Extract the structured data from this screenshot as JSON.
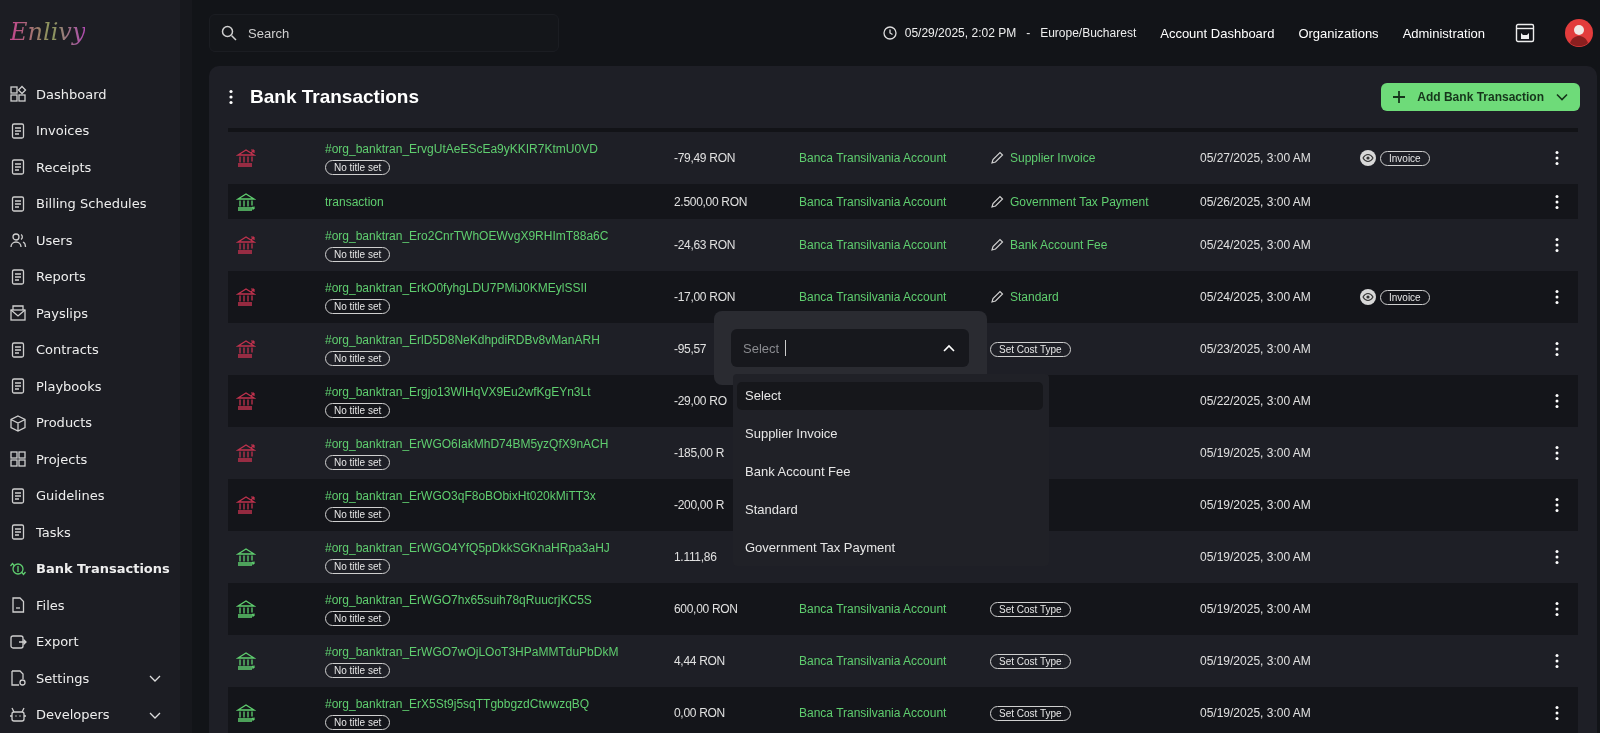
{
  "logo": "Enlivy",
  "sidebar": {
    "items": [
      {
        "label": "Dashboard",
        "selected": false
      },
      {
        "label": "Invoices",
        "selected": false
      },
      {
        "label": "Receipts",
        "selected": false
      },
      {
        "label": "Billing Schedules",
        "selected": false
      },
      {
        "label": "Users",
        "selected": false
      },
      {
        "label": "Reports",
        "selected": false
      },
      {
        "label": "Payslips",
        "selected": false
      },
      {
        "label": "Contracts",
        "selected": false
      },
      {
        "label": "Playbooks",
        "selected": false
      },
      {
        "label": "Products",
        "selected": false
      },
      {
        "label": "Projects",
        "selected": false
      },
      {
        "label": "Guidelines",
        "selected": false
      },
      {
        "label": "Tasks",
        "selected": false
      },
      {
        "label": "Bank Transactions",
        "selected": true
      },
      {
        "label": "Files",
        "selected": false
      },
      {
        "label": "Export",
        "selected": false
      },
      {
        "label": "Settings",
        "selected": false,
        "expanded": false
      },
      {
        "label": "Developers",
        "selected": false,
        "expanded": false
      }
    ]
  },
  "topbar": {
    "search": {
      "placeholder": "Search"
    },
    "datetime": "05/29/2025, 2:02 PM",
    "separator": "-",
    "timezone": "Europe/Bucharest",
    "links": [
      "Account Dashboard",
      "Organizations",
      "Administration"
    ]
  },
  "page": {
    "title": "Bank Transactions",
    "add_button": "Add Bank Transaction"
  },
  "table": {
    "rows": [
      {
        "kind": "outgoing",
        "id": "#org_banktran_ErvgUtAeEScEa9yKKIR7KtmU0VD",
        "title_badge": "No title set",
        "amount": "-79,49 RON",
        "account": "Banca Transilvania Account",
        "cost_type": "Supplier Invoice",
        "date": "05/27/2025, 3:00 AM",
        "document": "Invoice"
      },
      {
        "kind": "incoming",
        "id": "transaction",
        "amount": "2.500,00 RON",
        "account": "Banca Transilvania Account",
        "cost_type": "Government Tax Payment",
        "date": "05/26/2025, 3:00 AM"
      },
      {
        "kind": "outgoing",
        "id": "#org_banktran_Ero2CnrTWhOEWvgX9RHImT88a6C",
        "title_badge": "No title set",
        "amount": "-24,63 RON",
        "account": "Banca Transilvania Account",
        "cost_type": "Bank Account Fee",
        "date": "05/24/2025, 3:00 AM"
      },
      {
        "kind": "outgoing",
        "id": "#org_banktran_ErkO0fyhgLDU7PMiJ0KMEylSSII",
        "title_badge": "No title set",
        "amount": "-17,00 RON",
        "account": "Banca Transilvania Account",
        "cost_type": "Standard",
        "date": "05/24/2025, 3:00 AM",
        "document": "Invoice"
      },
      {
        "kind": "outgoing",
        "id": "#org_banktran_ErlD5D8NeKdhpdiRDBv8vManARH",
        "title_badge": "No title set",
        "amount": "-95,57",
        "cost_button": "Set Cost Type",
        "date": "05/23/2025, 3:00 AM"
      },
      {
        "kind": "outgoing",
        "id": "#org_banktran_Ergjo13WIHqVX9Eu2wfKgEYn3Lt",
        "title_badge": "No title set",
        "amount": "-29,00 RO",
        "date": "05/22/2025, 3:00 AM"
      },
      {
        "kind": "outgoing",
        "id": "#org_banktran_ErWGO6IakMhD74BM5yzQfX9nACH",
        "title_badge": "No title set",
        "amount": "-185,00 R",
        "date": "05/19/2025, 3:00 AM"
      },
      {
        "kind": "outgoing",
        "id": "#org_banktran_ErWGO3qF8oBObixHt020kMiTT3x",
        "title_badge": "No title set",
        "amount": "-200,00 R",
        "date": "05/19/2025, 3:00 AM"
      },
      {
        "kind": "incoming",
        "id": "#org_banktran_ErWGO4YfQ5pDkkSGKnaHRpa3aHJ",
        "title_badge": "No title set",
        "amount": "1.111,86",
        "date": "05/19/2025, 3:00 AM"
      },
      {
        "kind": "incoming",
        "id": "#org_banktran_ErWGO7hx65suih78qRuucrjKC5S",
        "title_badge": "No title set",
        "amount": "600,00 RON",
        "account": "Banca Transilvania Account",
        "cost_button": "Set Cost Type",
        "date": "05/19/2025, 3:00 AM"
      },
      {
        "kind": "incoming",
        "id": "#org_banktran_ErWGO7wOjLOoT3HPaMMTduPbDkM",
        "title_badge": "No title set",
        "amount": "4,44 RON",
        "account": "Banca Transilvania Account",
        "cost_button": "Set Cost Type",
        "date": "05/19/2025, 3:00 AM"
      },
      {
        "kind": "incoming",
        "id": "#org_banktran_ErX5St9j5sqTTgbbgzdCtwwzqBQ",
        "title_badge": "No title set",
        "amount": "0,00 RON",
        "account": "Banca Transilvania Account",
        "cost_button": "Set Cost Type",
        "date": "05/19/2025, 3:00 AM"
      }
    ]
  },
  "cost_dropdown": {
    "placeholder": "Select",
    "expanded": true,
    "options": [
      {
        "label": "Select",
        "selected": true
      },
      {
        "label": "Supplier Invoice",
        "selected": false
      },
      {
        "label": "Bank Account Fee",
        "selected": false
      },
      {
        "label": "Standard",
        "selected": false
      },
      {
        "label": "Government Tax Payment",
        "selected": false
      }
    ]
  }
}
